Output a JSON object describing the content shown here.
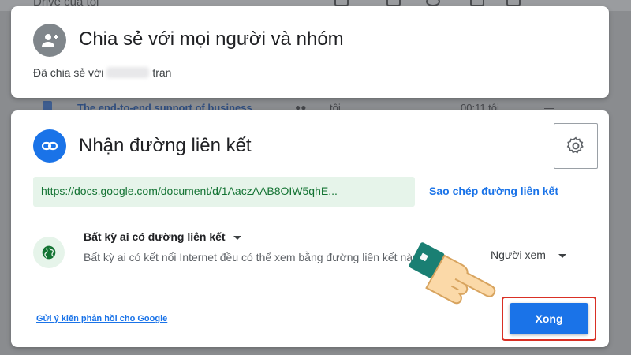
{
  "background": {
    "app_title": "Drive của tôi",
    "row_title": "The end-to-end support of business ...",
    "row_owner": "tôi",
    "row_time": "00:11 tôi",
    "row_size": "—"
  },
  "share_card": {
    "title": "Chia sẻ với mọi người và nhóm",
    "shared_prefix": "Đã chia sẻ với",
    "shared_name_suffix": "tran",
    "icon": "person-add-icon"
  },
  "link_card": {
    "title": "Nhận đường liên kết",
    "icon": "link-icon",
    "settings_icon": "gear-icon",
    "url": "https://docs.google.com/document/d/1AaczAAB8OIW5qhE...",
    "copy_label": "Sao chép đường liên kết",
    "access_title": "Bất kỳ ai có đường liên kết",
    "access_desc": "Bất kỳ ai có kết nối Internet đều có thể xem bằng đường liên kết này",
    "role_label": "Người xem",
    "feedback_label": "Gửi ý kiến phản hồi cho Google",
    "done_label": "Xong"
  },
  "colors": {
    "accent": "#1a73e8",
    "link_bg": "#e6f4ea",
    "link_text": "#137333",
    "highlight": "#d93025"
  }
}
